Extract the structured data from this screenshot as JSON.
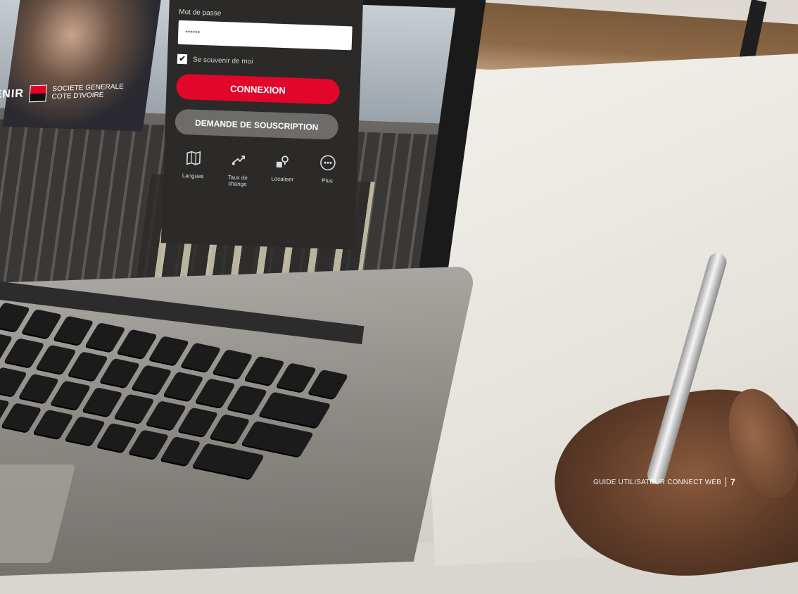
{
  "login": {
    "password_label": "Mot de passe",
    "password_value": "••••••",
    "remember_label": "Se souvenir de moi",
    "remember_checked": true,
    "connect_button": "CONNEXION",
    "subscribe_button": "DEMANDE DE SOUSCRIPTION",
    "tools": [
      {
        "label": "Langues",
        "icon": "map-icon"
      },
      {
        "label": "Taux de change",
        "icon": "exchange-icon"
      },
      {
        "label": "Localiser",
        "icon": "location-icon"
      },
      {
        "label": "Plus",
        "icon": "more-icon"
      }
    ]
  },
  "brand": {
    "tagline": "VENIR",
    "name_line1": "SOCIETE GENERALE",
    "name_line2": "COTE D'IVOIRE",
    "colors": {
      "red": "#e60028",
      "black": "#111111"
    }
  },
  "footer": {
    "guide": "GUIDE UTILISATEUR CONNECT WEB",
    "page": "7"
  },
  "colors": {
    "accent": "#e2062b",
    "secondary_button": "#6d6c6a",
    "panel": "#2b2a29"
  }
}
